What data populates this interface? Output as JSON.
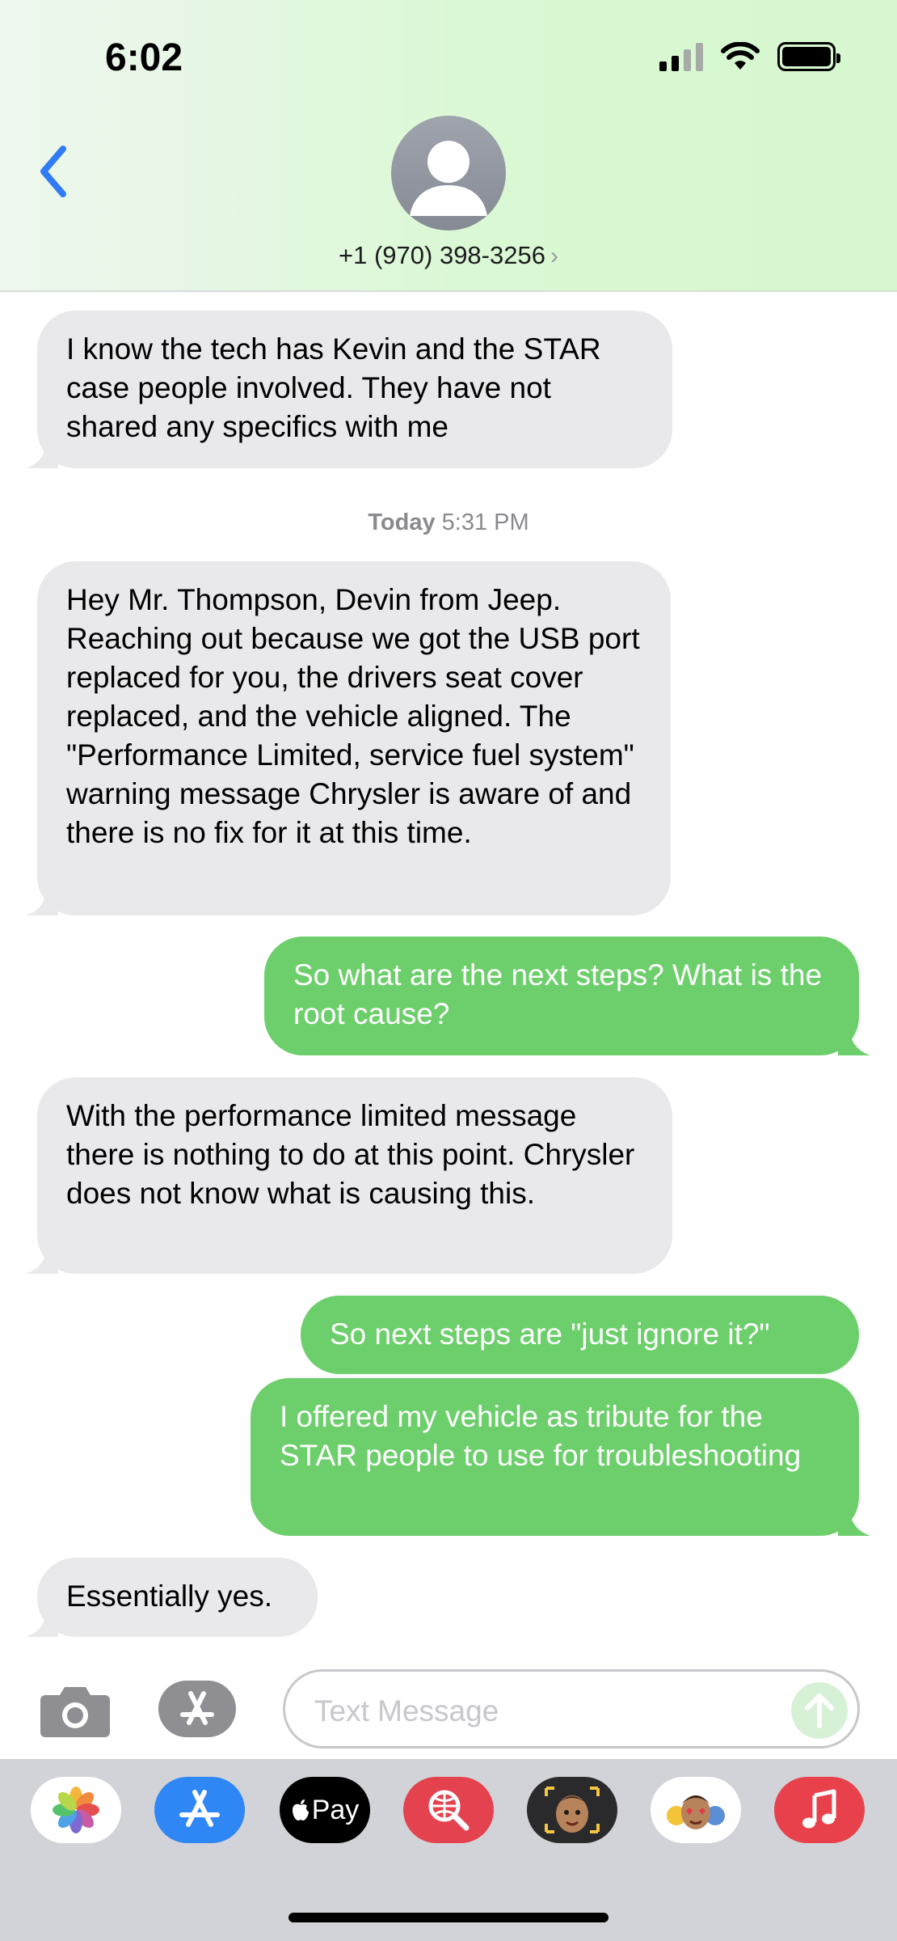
{
  "status_bar": {
    "time": "6:02"
  },
  "header": {
    "contact": "+1 (970) 398-3256",
    "chevron": "›"
  },
  "messages": {
    "m1": "I know the tech has Kevin and the STAR case people involved.  They have not shared any specifics with me",
    "timestamp_day": "Today",
    "timestamp_time": "5:31 PM",
    "m2": "Hey Mr. Thompson, Devin from Jeep. Reaching out because we got the USB port replaced for you, the drivers seat cover replaced, and the vehicle aligned. The \"Performance Limited, service fuel system\" warning message Chrysler is aware of and there is no fix for it at this time.",
    "m3": "So what are the next steps? What is the root cause?",
    "m4": "With the performance limited message there is nothing to do at this point. Chrysler does not know what is causing this.",
    "m5": "So next steps are \"just ignore it?\"",
    "m6": "I offered my vehicle as tribute for the STAR people to use for troubleshooting",
    "m7": "Essentially yes."
  },
  "compose": {
    "placeholder": "Text Message"
  },
  "drawer": {
    "apple_pay_label": "Pay"
  },
  "colors": {
    "incoming": "#e9e9eb",
    "outgoing": "#6ccf6b",
    "accent": "#2f7cf6"
  }
}
